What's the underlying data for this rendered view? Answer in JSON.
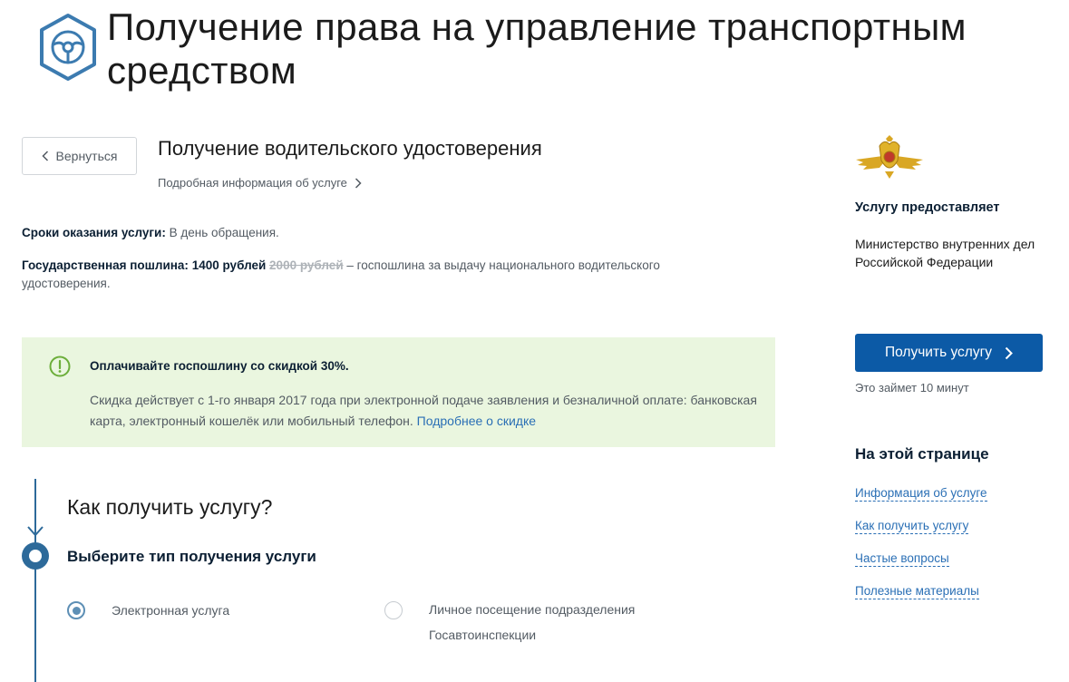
{
  "header": {
    "title": "Получение права на управление транспортным средством",
    "icon": "steering-wheel-icon"
  },
  "service": {
    "back_label": "Вернуться",
    "title": "Получение водительского удостоверения",
    "more_link": "Подробная информация об услуге",
    "terms_label": "Сроки оказания услуги:",
    "terms_value": "В день обращения.",
    "fee_label": "Государственная пошлина:",
    "fee_price": "1400 рублей",
    "fee_old_price": "2000 рублей",
    "fee_desc": "– госпошлина за выдачу национального водительского удостоверения."
  },
  "discount": {
    "title": "Оплачивайте госпошлину со скидкой 30%.",
    "text": "Скидка действует с 1-го января 2017 года при электронной подаче заявления и безналичной оплате: банковская карта, электронный кошелёк или мобильный телефон.",
    "link": "Подробнее о скидке",
    "bg_color": "#eaf6df"
  },
  "steps": {
    "question": "Как получить услугу?",
    "choose_type": "Выберите тип получения услуги",
    "options": [
      {
        "label": "Электронная услуга",
        "selected": true
      },
      {
        "label": "Личное посещение подразделения Госавтоинспекции",
        "selected": false
      }
    ]
  },
  "sidebar": {
    "provider_heading": "Услугу предоставляет",
    "provider_name": "Министерство внутренних дел Российской Федерации",
    "get_button": "Получить услугу",
    "time_note": "Это займет 10 минут",
    "on_page_heading": "На этой странице",
    "links": [
      "Информация об услуге",
      "Как получить услугу",
      "Частые вопросы",
      "Полезные материалы"
    ],
    "button_color": "#0c5aa6"
  }
}
